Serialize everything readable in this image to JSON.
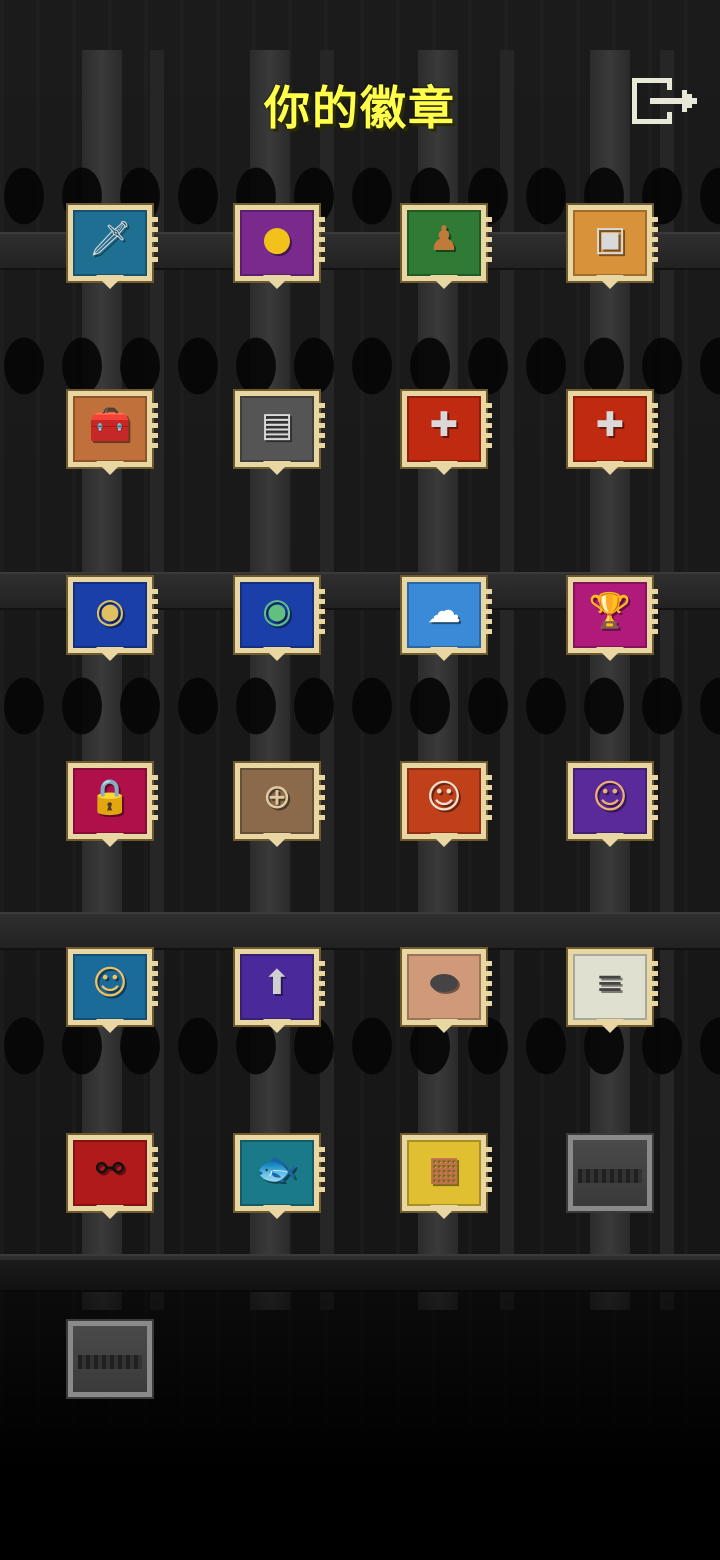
{
  "screen": {
    "title": "你的徽章"
  },
  "exit_button": {
    "icon": "exit-door-icon"
  },
  "badges": [
    {
      "icon": "sword-icon",
      "glyph": "🗡",
      "color": "#1f6f93"
    },
    {
      "icon": "gold-icon",
      "glyph": "●",
      "color": "#7a2a8c",
      "glyph_color": "#f2c21a"
    },
    {
      "icon": "pawn-icon",
      "glyph": "♟",
      "color": "#2f7a34",
      "glyph_color": "#c07a3a"
    },
    {
      "icon": "armor-icon",
      "glyph": "▣",
      "color": "#d8923a"
    },
    {
      "icon": "bag-icon",
      "glyph": "🧰",
      "color": "#c0703a"
    },
    {
      "icon": "armor-icon",
      "glyph": "▤",
      "color": "#555555"
    },
    {
      "icon": "plus-icon",
      "glyph": "✚",
      "color": "#c02a10"
    },
    {
      "icon": "plus-icon",
      "glyph": "✚",
      "color": "#c02a10"
    },
    {
      "icon": "rainbow-orb-icon",
      "glyph": "◉",
      "color": "#1a3fa8",
      "glyph_color": "#e0c060"
    },
    {
      "icon": "rainbow-orb-icon",
      "glyph": "◉",
      "color": "#1a3fa8",
      "glyph_color": "#60c080"
    },
    {
      "icon": "cloud-icon",
      "glyph": "☁",
      "color": "#3a8ad8",
      "glyph_color": "#ffffff"
    },
    {
      "icon": "trophy-icon",
      "glyph": "🏆",
      "color": "#b01a7a",
      "glyph_color": "#f2c21a"
    },
    {
      "icon": "padlock-icon",
      "glyph": "🔒",
      "color": "#b0104a",
      "glyph_color": "#222222"
    },
    {
      "icon": "rune-icon",
      "glyph": "⊕",
      "color": "#8a6a4a",
      "glyph_color": "#e0c8a0"
    },
    {
      "icon": "old-hero-face-icon",
      "glyph": "☺",
      "color": "#c0401a",
      "glyph_color": "#f0e0d0"
    },
    {
      "icon": "hero-face-icon",
      "glyph": "☺",
      "color": "#5a2a9a",
      "glyph_color": "#f0b070"
    },
    {
      "icon": "blonde-hero-face-icon",
      "glyph": "☺",
      "color": "#1a6a9a",
      "glyph_color": "#f2c060"
    },
    {
      "icon": "arrow-up-icon",
      "glyph": "⬆",
      "color": "#4a2a9a",
      "glyph_color": "#d0d0d0"
    },
    {
      "icon": "stone-icon",
      "glyph": "⬬",
      "color": "#d09a7a",
      "glyph_color": "#444444"
    },
    {
      "icon": "teeth-icon",
      "glyph": "≡",
      "color": "#e0e0d0",
      "glyph_color": "#444444"
    },
    {
      "icon": "glasses-icon",
      "glyph": "⚯",
      "color": "#b01a1a",
      "glyph_color": "#111111"
    },
    {
      "icon": "fish-icon",
      "glyph": "🐟",
      "color": "#1a7a8a",
      "glyph_color": "#c0b0d0"
    },
    {
      "icon": "chest-icon",
      "glyph": "▦",
      "color": "#e0c030",
      "glyph_color": "#c07050"
    },
    {
      "icon": "locked-slot-icon",
      "glyph": "",
      "color": "#444444",
      "locked": true
    },
    {
      "icon": "locked-slot-icon",
      "glyph": "",
      "color": "#444444",
      "locked": true
    }
  ]
}
